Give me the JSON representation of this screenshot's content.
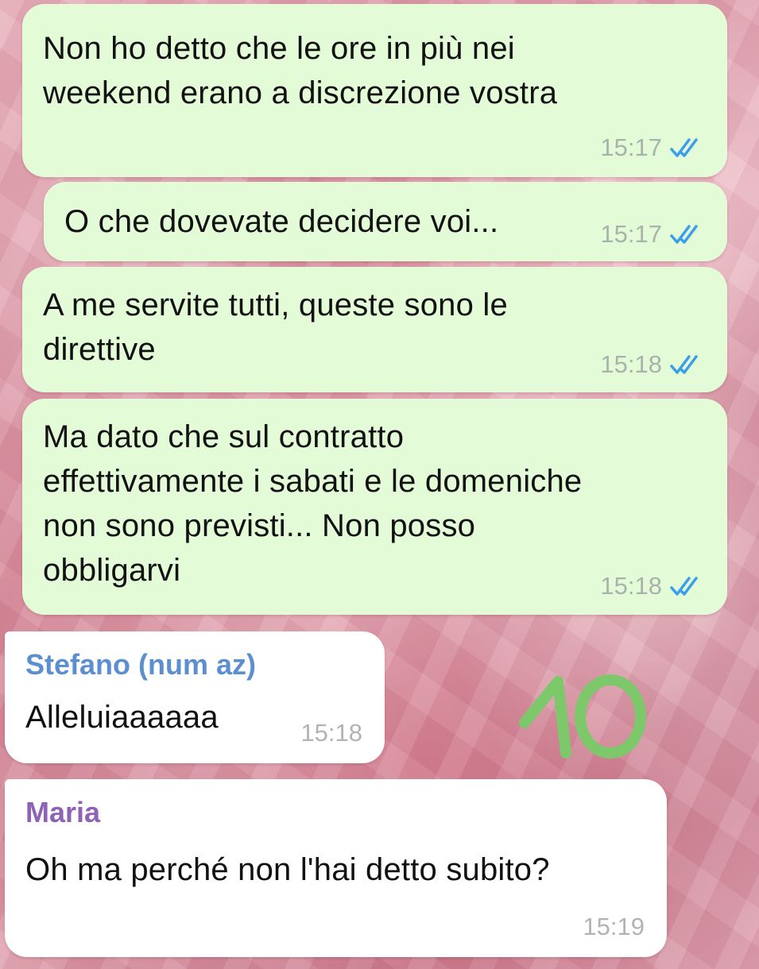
{
  "colors": {
    "outgoing_bubble": "#e4fbd8",
    "incoming_bubble": "#ffffff",
    "read_ticks": "#3a9ee8",
    "sender_stefano": "#5b8fcf",
    "sender_maria": "#8e63b5",
    "annotation": "#7cc86a"
  },
  "messages": [
    {
      "direction": "outgoing",
      "text": "Non ho detto che le ore in più nei\nweekend erano a discrezione vostra",
      "time": "15:17",
      "status_icon": "double-check-read-icon"
    },
    {
      "direction": "outgoing",
      "text": "O che dovevate decidere voi...",
      "time": "15:17",
      "status_icon": "double-check-read-icon"
    },
    {
      "direction": "outgoing",
      "text": "A me servite tutti, queste sono le\ndirettive",
      "time": "15:18",
      "status_icon": "double-check-read-icon"
    },
    {
      "direction": "outgoing",
      "text": "Ma dato che sul contratto\neffettivamente i sabati e le domeniche\nnon sono previsti... Non posso\nobbligarvi",
      "time": "15:18",
      "status_icon": "double-check-read-icon"
    },
    {
      "direction": "incoming",
      "sender": "Stefano (num az)",
      "text": "Alleluiaaaaaa",
      "time": "15:18"
    },
    {
      "direction": "incoming",
      "sender": "Maria",
      "text": "Oh ma perché non l'hai detto subito?",
      "time": "15:19"
    }
  ],
  "annotation": {
    "text": "10"
  }
}
